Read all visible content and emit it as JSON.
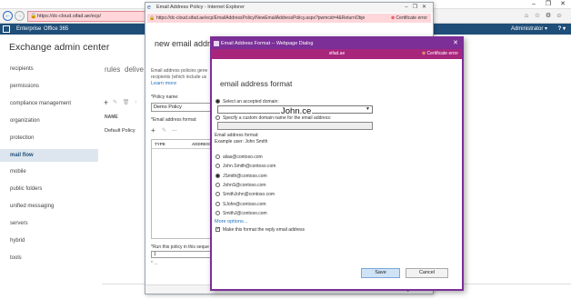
{
  "browser": {
    "url": "https://dc-cloud.sifad.ae/ecp/",
    "right_icons": [
      "home-icon",
      "star-icon",
      "gear-icon",
      "smiley-icon"
    ]
  },
  "o365": {
    "enterprise_label": "Enterprise",
    "office_label": "Office 365",
    "user": "Administrator ▾",
    "help": "? ▾"
  },
  "eac": {
    "title": "Exchange admin center",
    "nav": [
      "recipients",
      "permissions",
      "compliance management",
      "organization",
      "protection",
      "mail flow",
      "mobile",
      "public folders",
      "unified messaging",
      "servers",
      "hybrid",
      "tools"
    ],
    "selected_nav_index": 5,
    "tab_rules": "rules",
    "tab_deliver": "delive",
    "toolbar_tools": "✎ 🗑 ↑",
    "column_name": "NAME",
    "row_default": "Default Policy"
  },
  "policy_window": {
    "title": "Email Address Policy - Internet Explorer",
    "url": "https://dc-cloud.sifad.ae/ecp/EmailAddressPolicy/NewEmailAddressPolicy.aspx?pwmcid=4&ReturnObje",
    "cert_error": "Certificate error",
    "heading": "new email address",
    "description_line1": "Email address policies gene",
    "description_line2": "recipients (which include us",
    "learn_more": "Learn more",
    "policy_name_label": "*Policy name:",
    "policy_name_value": "Demo Policy",
    "format_label": "*Email address format:",
    "format_tools": "✎ —",
    "col_type": "TYPE",
    "col_address": "ADDRESS",
    "run_label": "*Run this policy in this seque",
    "run_value": "1",
    "more_text": "* ...",
    "zoom": "🔍 100% ▾"
  },
  "dialog": {
    "title": "Email Address Format -- Webpage Dialog",
    "url": "sifad.ae",
    "cert_error": "Certificate error",
    "heading": "email address format",
    "select_domain_label": "Select an accepted domain:",
    "selected_domain": "",
    "overlay_text": "John.ce",
    "custom_domain_label": "Specify a custom domain name for the email address:",
    "format_label": "Email address format:",
    "example": "Example user: John Smith",
    "options": [
      "alias@contoso.com",
      "John.Smith@contoso.com",
      "JSmith@contoso.com",
      "JohnS@contoso.com",
      "SmithJohn@contoso.com",
      "SJohn@contoso.com",
      "SmithJ@contoso.com"
    ],
    "selected_option_index": 2,
    "more_options": "More options...",
    "reply_checkbox_label": "Make this format the reply email address",
    "reply_checked": true,
    "save": "Save",
    "cancel": "Cancel"
  }
}
